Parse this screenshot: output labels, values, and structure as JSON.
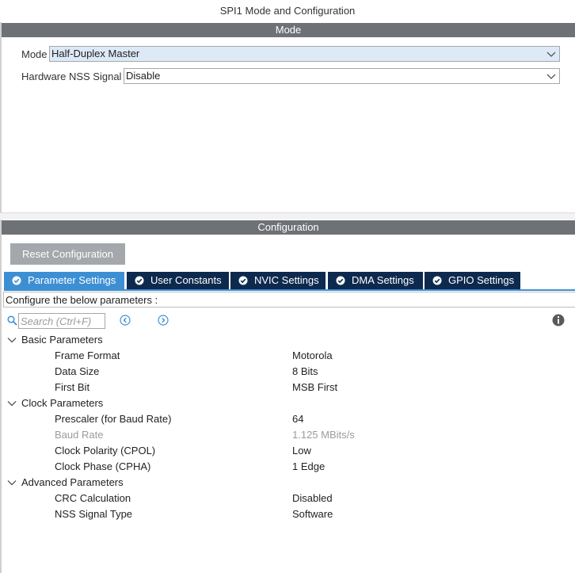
{
  "window": {
    "title": "SPI1 Mode and Configuration"
  },
  "mode_section": {
    "header": "Mode",
    "mode_label": "Mode",
    "mode_value": "Half-Duplex Master",
    "nss_label": "Hardware NSS Signal",
    "nss_value": "Disable"
  },
  "config_section": {
    "header": "Configuration",
    "reset_label": "Reset Configuration",
    "tabs": [
      {
        "label": "Parameter Settings",
        "active": true
      },
      {
        "label": "User Constants",
        "active": false
      },
      {
        "label": "NVIC Settings",
        "active": false
      },
      {
        "label": "DMA Settings",
        "active": false
      },
      {
        "label": "GPIO Settings",
        "active": false
      }
    ],
    "subtitle": "Configure the below parameters :",
    "search_placeholder": "Search (Ctrl+F)",
    "groups": [
      {
        "title": "Basic Parameters",
        "params": [
          {
            "name": "Frame Format",
            "value": "Motorola",
            "disabled": false
          },
          {
            "name": "Data Size",
            "value": "8 Bits",
            "disabled": false
          },
          {
            "name": "First Bit",
            "value": "MSB First",
            "disabled": false
          }
        ]
      },
      {
        "title": "Clock Parameters",
        "params": [
          {
            "name": "Prescaler (for Baud Rate)",
            "value": "64",
            "disabled": false
          },
          {
            "name": "Baud Rate",
            "value": "1.125 MBits/s",
            "disabled": true
          },
          {
            "name": "Clock Polarity (CPOL)",
            "value": "Low",
            "disabled": false
          },
          {
            "name": "Clock Phase (CPHA)",
            "value": "1 Edge",
            "disabled": false
          }
        ]
      },
      {
        "title": "Advanced Parameters",
        "params": [
          {
            "name": "CRC Calculation",
            "value": "Disabled",
            "disabled": false
          },
          {
            "name": "NSS Signal Type",
            "value": "Software",
            "disabled": false
          }
        ]
      }
    ]
  },
  "colors": {
    "header_bar": "#6e7176",
    "tab_dark": "#0d2a4e",
    "tab_active": "#3d8fd4",
    "select_highlight": "#dde9f7"
  },
  "icons": [
    "chevron-down-icon",
    "check-circle-icon",
    "search-icon",
    "arrow-left-circle-icon",
    "arrow-right-circle-icon",
    "info-icon",
    "expand-chevron-icon"
  ]
}
